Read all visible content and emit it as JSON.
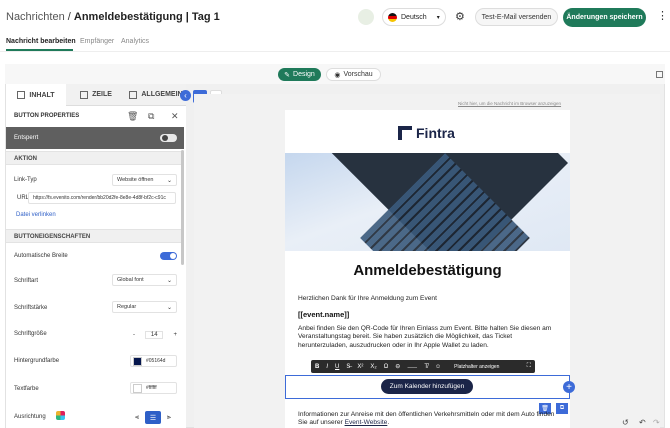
{
  "header": {
    "crumb": "Nachrichten",
    "separator": "/",
    "title": "Anmeldebestätigung | Tag 1",
    "language": "Deutsch",
    "test_email_label": "Test-E-Mail versenden",
    "save_label": "Änderungen speichern"
  },
  "tabs": [
    "Nachricht bearbeiten",
    "Empfänger",
    "Analytics"
  ],
  "modes": {
    "design": "Design",
    "preview": "Vorschau"
  },
  "panel": {
    "tabs": [
      "INHALT",
      "ZEILE",
      "ALLGEMEIN"
    ],
    "props_title": "BUTTON PROPERTIES",
    "entsperrt": "Entsperrt",
    "section_aktion": "AKTION",
    "link_typ_label": "Link-Typ",
    "link_typ_value": "Website öffnen",
    "url_label": "URL",
    "url_value": "https://fs.evenito.com/render/bb20d2fe-8e8e-4d8f-bf2c-c91c",
    "datei_link": "Datei verlinken",
    "section_props": "BUTTONEIGENSCHAFTEN",
    "auto_width": "Automatische Breite",
    "schriftart_label": "Schriftart",
    "schriftart_value": "Global font",
    "schriftstaerke_label": "Schriftstärke",
    "schriftstaerke_value": "Regular",
    "schriftgroesse_label": "Schriftgröße",
    "schriftgroesse_value": "14",
    "bg_label": "Hintergrundfarbe",
    "bg_value": "#05164d",
    "text_label": "Textfarbe",
    "text_value": "#ffffff",
    "align_label": "Ausrichtung"
  },
  "email": {
    "browser_link": "Nicht hier, um die Nachricht im Browser anzuzeigen",
    "logo": "Fintra",
    "title": "Anmeldebestätigung",
    "intro": "Herzlichen Dank für Ihre Anmeldung zum Event",
    "event_name": "[[event.name]]",
    "body": "Anbei finden Sie den QR-Code für Ihren Einlass zum Event. Bitte halten Sie diesen am Veranstaltungstag bereit. Sie haben zusätzlich die Möglichkeit, das Ticket herunterzuladen, auszudrucken oder in Ihr Apple Wallet zu laden.",
    "button": "Zum Kalender hinzufügen",
    "footer_text": "Informationen zur Anreise mit den öffentlichen Verkehrsmitteln oder mit dem Auto finden Sie auf unserer",
    "footer_link": "Event-Website",
    "toolbar_placeholder": "Platzhalter anzeigen"
  },
  "colors": {
    "brand_green": "#1f7a5a",
    "accent_blue": "#3d6bd8",
    "navy": "#1b2548"
  }
}
